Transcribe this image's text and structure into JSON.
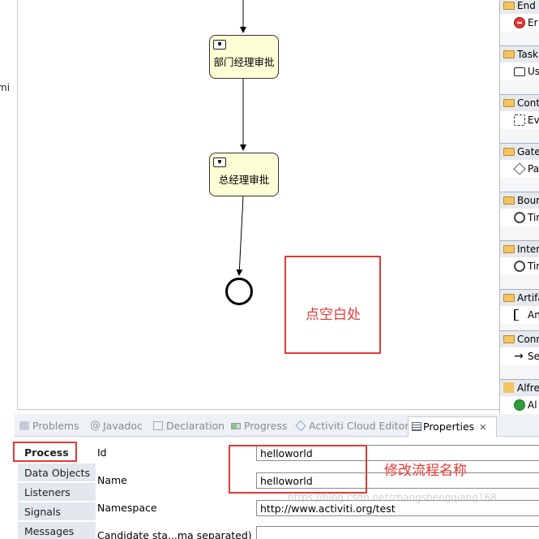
{
  "left_gutter_fragment": "mi",
  "canvas": {
    "tasks": [
      {
        "label": "部门经理审批"
      },
      {
        "label": "总经理审批"
      }
    ],
    "annotation_canvas": "点空白处"
  },
  "palette": {
    "groups": [
      {
        "header": "End",
        "item": "Er"
      },
      {
        "header": "Task",
        "item": "Us"
      },
      {
        "header": "Cont",
        "item": "Ev"
      },
      {
        "header": "Gate",
        "item": "Pa"
      },
      {
        "header": "Bour",
        "item": "Tir"
      },
      {
        "header": "Inter",
        "item": "Tir"
      },
      {
        "header": "Artifa",
        "item": "An"
      },
      {
        "header": "Conn",
        "item": "Se"
      },
      {
        "header": "Alfre",
        "item": "Al"
      }
    ]
  },
  "bottom_tabs": [
    {
      "label": "Problems",
      "icon": "problems-icon"
    },
    {
      "label": "Javadoc",
      "icon": "javadoc-icon"
    },
    {
      "label": "Declaration",
      "icon": "declaration-icon"
    },
    {
      "label": "Progress",
      "icon": "progress-icon"
    },
    {
      "label": "Activiti Cloud Editor",
      "icon": "cloud-editor-icon"
    },
    {
      "label": "Properties",
      "icon": "properties-icon",
      "active": true
    }
  ],
  "properties": {
    "side_tabs": [
      "Process",
      "Data Objects",
      "Listeners",
      "Signals",
      "Messages"
    ],
    "fields": [
      {
        "label": "Id",
        "value": "helloworld"
      },
      {
        "label": "Name",
        "value": "helloworld"
      },
      {
        "label": "Namespace",
        "value": "http://www.activiti.org/test"
      },
      {
        "label": "Candidate sta...ma separated)",
        "value": ""
      }
    ],
    "annotation_name": "修改流程名称"
  },
  "watermark": "https://blog.csdn.net/zhangshengqiang168",
  "colors": {
    "task_fill": "#ffffd6",
    "annotation_red": "#e53935",
    "palette_bg": "#eef0f4"
  }
}
